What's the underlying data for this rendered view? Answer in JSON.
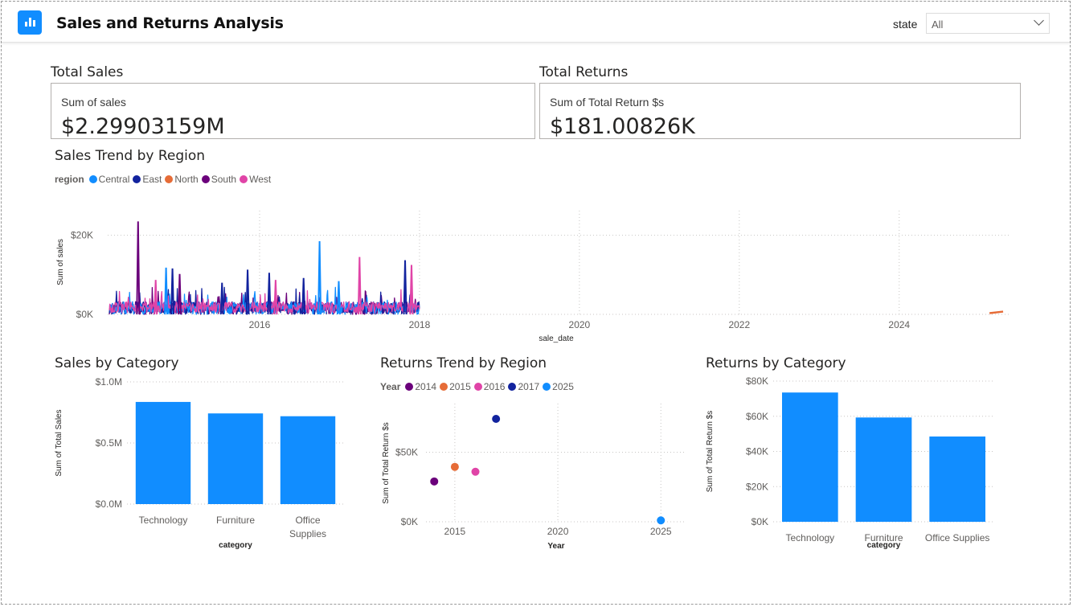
{
  "header": {
    "title": "Sales and Returns Analysis",
    "state_label": "state",
    "state_value": "All"
  },
  "cards": {
    "sales": {
      "title": "Total Sales",
      "subtitle": "Sum of sales",
      "value": "$2.29903159M"
    },
    "returns": {
      "title": "Total Returns",
      "subtitle": "Sum of Total Return $s",
      "value": "$181.00826K"
    }
  },
  "colors": {
    "accent": "#118dff",
    "Central": "#118dff",
    "East": "#12239e",
    "North": "#e66c37",
    "South": "#6b007b",
    "West": "#e044a7"
  },
  "trend": {
    "title": "Sales Trend by Region",
    "legend_title": "region",
    "legend": [
      "Central",
      "East",
      "North",
      "South",
      "West"
    ]
  },
  "returns_trend": {
    "title": "Returns Trend by Region",
    "legend_title": "Year",
    "legend": [
      "2014",
      "2015",
      "2016",
      "2017",
      "2025"
    ]
  },
  "sales_cat": {
    "title": "Sales by Category"
  },
  "returns_cat": {
    "title": "Returns by Category"
  },
  "chart_data": [
    {
      "type": "line",
      "title": "Sales Trend by Region",
      "xlabel": "sale_date",
      "ylabel": "Sum of sales",
      "xlim": [
        2014.1,
        2025.4
      ],
      "ylim": [
        0,
        25000
      ],
      "x_ticks": [
        "2016",
        "2018",
        "2020",
        "2022",
        "2024"
      ],
      "y_ticks": [
        "$0K",
        "$20K"
      ],
      "grid": true,
      "legend_position": "top-left",
      "spikes": [
        {
          "series": "South",
          "x": 2014.48,
          "y": 23500
        },
        {
          "series": "Central",
          "x": 2016.75,
          "y": 18500
        },
        {
          "series": "West",
          "x": 2017.25,
          "y": 14500
        },
        {
          "series": "East",
          "x": 2017.82,
          "y": 13700
        },
        {
          "series": "Central",
          "x": 2014.83,
          "y": 11800
        },
        {
          "series": "East",
          "x": 2014.91,
          "y": 11600
        },
        {
          "series": "East",
          "x": 2015.85,
          "y": 11300
        },
        {
          "series": "West",
          "x": 2017.9,
          "y": 12500
        },
        {
          "series": "East",
          "x": 2016.12,
          "y": 10500
        },
        {
          "series": "South",
          "x": 2015.0,
          "y": 10200
        },
        {
          "series": "West",
          "x": 2014.7,
          "y": 8700
        },
        {
          "series": "East",
          "x": 2016.55,
          "y": 9200
        },
        {
          "series": "Central",
          "x": 2016.99,
          "y": 8400
        },
        {
          "series": "East",
          "x": 2015.53,
          "y": 8000
        },
        {
          "series": "West",
          "x": 2016.2,
          "y": 8700
        }
      ],
      "north_segment": [
        {
          "x": 2025.13,
          "y": 300
        },
        {
          "x": 2025.3,
          "y": 700
        }
      ]
    },
    {
      "type": "bar",
      "title": "Sales by Category",
      "xlabel": "category",
      "ylabel": "Sum of Total Sales",
      "categories": [
        "Technology",
        "Furniture",
        "Office Supplies"
      ],
      "values": [
        836000,
        742000,
        719000
      ],
      "ylim": [
        0,
        1000000
      ],
      "y_ticks": [
        "$0.0M",
        "$0.5M",
        "$1.0M"
      ]
    },
    {
      "type": "scatter",
      "title": "Returns Trend by Region",
      "xlabel": "Year",
      "ylabel": "Sum of Total Return $s",
      "x_ticks": [
        "2015",
        "2020",
        "2025"
      ],
      "y_ticks": [
        "$0K",
        "$50K"
      ],
      "xlim": [
        2013.6,
        2026.2
      ],
      "ylim": [
        0,
        85000
      ],
      "points": [
        {
          "year": 2014,
          "value": 29000
        },
        {
          "year": 2015,
          "value": 39500
        },
        {
          "year": 2016,
          "value": 36000
        },
        {
          "year": 2017,
          "value": 74000
        },
        {
          "year": 2025,
          "value": 1000
        }
      ]
    },
    {
      "type": "bar",
      "title": "Returns by Category",
      "xlabel": "category",
      "ylabel": "Sum of Total Return $s",
      "categories": [
        "Technology",
        "Furniture",
        "Office Supplies"
      ],
      "values": [
        73500,
        59300,
        48500
      ],
      "ylim": [
        0,
        80000
      ],
      "y_ticks": [
        "$0K",
        "$20K",
        "$40K",
        "$60K",
        "$80K"
      ]
    }
  ]
}
